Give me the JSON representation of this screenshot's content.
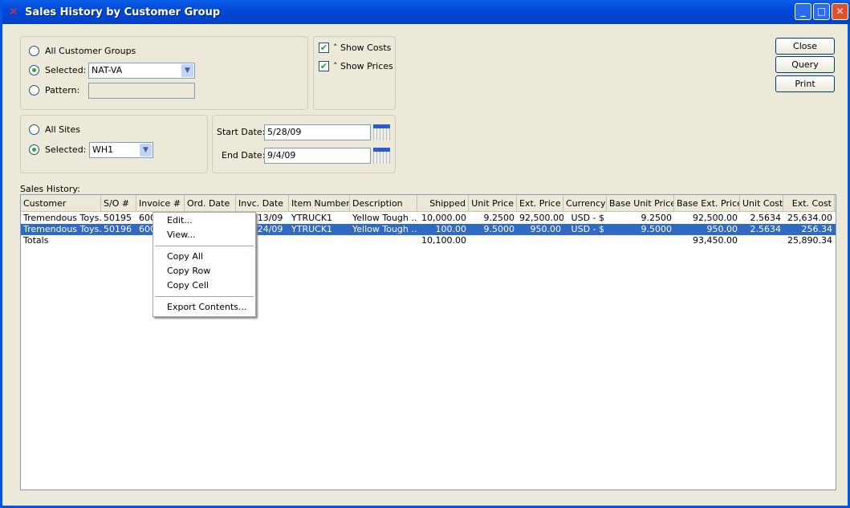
{
  "window": {
    "title": "Sales History by Customer Group",
    "minimize": "_",
    "maximize": "□",
    "close": "✕"
  },
  "customer_groups": {
    "all_label": "All Customer Groups",
    "selected_label": "Selected:",
    "selected_value": "NAT-VA",
    "pattern_label": "Pattern:",
    "pattern_value": "",
    "mode": "selected"
  },
  "options": {
    "show_costs_label": "Show Costs",
    "show_costs": true,
    "show_prices_label": "Show Prices",
    "show_prices": true
  },
  "sites": {
    "all_label": "All Sites",
    "selected_label": "Selected:",
    "selected_value": "WH1",
    "mode": "selected"
  },
  "dates": {
    "start_label": "Start Date:",
    "start_value": "5/28/09",
    "end_label": "End Date:",
    "end_value": "9/4/09"
  },
  "buttons": {
    "close": "Close",
    "query": "Query",
    "print": "Print"
  },
  "grid": {
    "label": "Sales History:",
    "columns": [
      "Customer",
      "S/O #",
      "Invoice #",
      "Ord. Date",
      "Invc. Date",
      "Item Number",
      "Description",
      "Shipped",
      "Unit Price",
      "Ext. Price",
      "Currency",
      "Base Unit Price",
      "Base Ext. Price",
      "Unit Cost",
      "Ext. Cost"
    ],
    "rows": [
      {
        "customer": "Tremendous Toys...",
        "so": "50195",
        "invoice": "600",
        "invc_date": "/13/09",
        "item": "YTRUCK1",
        "description": "Yellow Tough ...",
        "shipped": "10,000.00",
        "unit_price": "9.2500",
        "ext_price": "92,500.00",
        "currency": "USD - $",
        "base_unit_price": "9.2500",
        "base_ext_price": "92,500.00",
        "unit_cost": "2.5634",
        "ext_cost": "25,634.00",
        "selected": false
      },
      {
        "customer": "Tremendous Toys...",
        "so": "50196",
        "invoice": "600",
        "invc_date": "/24/09",
        "item": "YTRUCK1",
        "description": "Yellow Tough ...",
        "shipped": "100.00",
        "unit_price": "9.5000",
        "ext_price": "950.00",
        "currency": "USD - $",
        "base_unit_price": "9.5000",
        "base_ext_price": "950.00",
        "unit_cost": "2.5634",
        "ext_cost": "256.34",
        "selected": true
      }
    ],
    "totals": {
      "label": "Totals",
      "shipped": "10,100.00",
      "base_ext_price": "93,450.00",
      "ext_cost": "25,890.34"
    }
  },
  "context_menu": {
    "items": [
      "Edit...",
      "View...",
      "Copy All",
      "Copy Row",
      "Copy Cell",
      "Export Contents..."
    ]
  },
  "colors": {
    "selection": "#316ac5",
    "titlebar": "#0054e3"
  }
}
